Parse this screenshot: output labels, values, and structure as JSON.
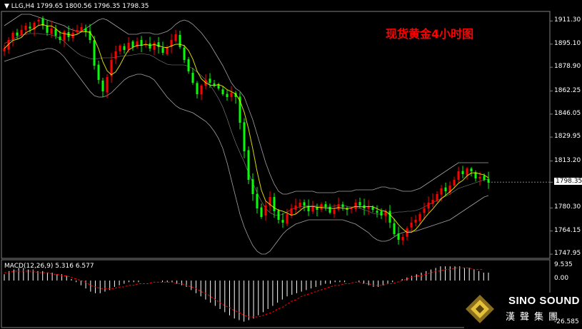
{
  "header": {
    "symbol": "LLG,H4",
    "ohlc": "1799.65 1800.56 1796.35 1798.35",
    "title": "现货黄金4小时图"
  },
  "macd": {
    "label": "MACD(12,26,9) 5.316 6.577",
    "tick_labels": [
      "9.535",
      "0.00",
      "-26.585"
    ]
  },
  "logo": {
    "brand": "SINO SOUND",
    "sub": "漢聲集團"
  },
  "colors": {
    "background": "#000000",
    "up_candle": "#ff0000",
    "down_candle": "#00ff00",
    "ma_line": "#ffff00",
    "bollinger": "#c0c0c0",
    "macd_signal": "#ff0000",
    "macd_hist": "#ffffff",
    "title": "#ff0000"
  },
  "chart_data": [
    {
      "type": "candlestick",
      "title": "现货黄金4小时图",
      "ylim": [
        1745,
        1918
      ],
      "y_ticks": [
        "1911.30",
        "1895.10",
        "1878.90",
        "1862.25",
        "1846.05",
        "1829.95",
        "1813.20",
        "1798.35",
        "1780.30",
        "1764.15",
        "1747.95"
      ],
      "current_price": 1798.35,
      "close": [
        1892,
        1898,
        1903,
        1901,
        1905,
        1908,
        1906,
        1910,
        1912,
        1908,
        1903,
        1906,
        1901,
        1898,
        1904,
        1900,
        1903,
        1905,
        1907,
        1904,
        1898,
        1880,
        1870,
        1862,
        1872,
        1884,
        1890,
        1894,
        1891,
        1896,
        1893,
        1897,
        1894,
        1895,
        1892,
        1896,
        1893,
        1889,
        1893,
        1898,
        1902,
        1893,
        1884,
        1876,
        1868,
        1860,
        1866,
        1870,
        1868,
        1866,
        1864,
        1860,
        1858,
        1861,
        1858,
        1840,
        1820,
        1800,
        1790,
        1780,
        1774,
        1782,
        1788,
        1778,
        1772,
        1770,
        1776,
        1780,
        1782,
        1784,
        1782,
        1778,
        1781,
        1779,
        1783,
        1781,
        1777,
        1779,
        1783,
        1781,
        1779,
        1780,
        1784,
        1782,
        1780,
        1781,
        1779,
        1777,
        1775,
        1778,
        1770,
        1762,
        1758,
        1760,
        1766,
        1770,
        1772,
        1776,
        1780,
        1784,
        1786,
        1790,
        1794,
        1792,
        1796,
        1800,
        1806,
        1804,
        1808,
        1806,
        1801,
        1802,
        1800,
        1798
      ],
      "bollinger_upper": [
        1908,
        1910,
        1912,
        1914,
        1916,
        1916,
        1916,
        1915,
        1914,
        1913,
        1912,
        1911,
        1910,
        1909,
        1908,
        1906,
        1905,
        1904,
        1904,
        1906,
        1908,
        1910,
        1912,
        1913,
        1912,
        1910,
        1908,
        1906,
        1904,
        1902,
        1902,
        1902,
        1903,
        1903,
        1903,
        1902,
        1902,
        1903,
        1904,
        1906,
        1909,
        1911,
        1912,
        1911,
        1909,
        1906,
        1903,
        1899,
        1895,
        1890,
        1885,
        1880,
        1874,
        1868,
        1864,
        1862,
        1858,
        1850,
        1842,
        1832,
        1822,
        1812,
        1804,
        1797,
        1792,
        1790,
        1790,
        1791,
        1792,
        1792,
        1792,
        1792,
        1792,
        1791,
        1791,
        1791,
        1791,
        1791,
        1792,
        1792,
        1792,
        1792,
        1793,
        1793,
        1793,
        1793,
        1793,
        1794,
        1795,
        1795,
        1794,
        1794,
        1793,
        1792,
        1792,
        1792,
        1793,
        1794,
        1796,
        1798,
        1800,
        1802,
        1804,
        1806,
        1808,
        1810,
        1812,
        1812,
        1812,
        1812,
        1812,
        1812,
        1812,
        1812
      ],
      "bollinger_lower": [
        1883,
        1884,
        1885,
        1886,
        1887,
        1888,
        1889,
        1890,
        1891,
        1891,
        1892,
        1892,
        1891,
        1889,
        1886,
        1882,
        1878,
        1874,
        1870,
        1866,
        1862,
        1859,
        1858,
        1858,
        1859,
        1861,
        1864,
        1867,
        1870,
        1872,
        1873,
        1874,
        1874,
        1873,
        1872,
        1870,
        1866,
        1862,
        1858,
        1855,
        1852,
        1850,
        1849,
        1848,
        1847,
        1845,
        1843,
        1841,
        1838,
        1834,
        1829,
        1822,
        1812,
        1800,
        1788,
        1776,
        1767,
        1760,
        1754,
        1750,
        1748,
        1748,
        1750,
        1754,
        1758,
        1762,
        1765,
        1767,
        1769,
        1770,
        1771,
        1772,
        1772,
        1772,
        1772,
        1772,
        1772,
        1772,
        1772,
        1772,
        1771,
        1770,
        1769,
        1767,
        1765,
        1763,
        1760,
        1758,
        1757,
        1757,
        1758,
        1760,
        1762,
        1763,
        1764,
        1764,
        1764,
        1765,
        1766,
        1767,
        1768,
        1769,
        1770,
        1771,
        1772,
        1774,
        1776,
        1778,
        1780,
        1782,
        1784,
        1786,
        1788,
        1789
      ]
    },
    {
      "type": "macd",
      "title": "MACD(12,26,9)",
      "macd_value": 5.316,
      "signal_value": 6.577,
      "ylim": [
        -26.585,
        9.535
      ],
      "histogram": [
        4,
        6,
        7,
        8,
        8,
        7,
        7,
        6,
        6,
        5,
        5,
        4,
        4,
        3,
        1,
        -1,
        -3,
        -5,
        -7,
        -8,
        -8,
        -7,
        -6,
        -4,
        -3,
        -2,
        -1,
        -1,
        -1,
        0,
        0,
        0,
        0,
        -1,
        -1,
        -1,
        -2,
        -3,
        -4,
        -6,
        -8,
        -10,
        -12,
        -14,
        -16,
        -18,
        -20,
        -22,
        -24,
        -25,
        -26,
        -25,
        -24,
        -22,
        -20,
        -18,
        -16,
        -14,
        -12,
        -10,
        -9,
        -8,
        -7,
        -6,
        -5,
        -4,
        -3,
        -2,
        -2,
        -1,
        -1,
        -1,
        0,
        0,
        -1,
        -2,
        -3,
        -4,
        -4,
        -3,
        -2,
        -1,
        0,
        1,
        2,
        3,
        4,
        5,
        6,
        7,
        8,
        9,
        9,
        9,
        9,
        9,
        8,
        8,
        7,
        6,
        5,
        5
      ],
      "signal": [
        5,
        5,
        6,
        6,
        6,
        6,
        6,
        5,
        5,
        5,
        4,
        4,
        3,
        3,
        2,
        1,
        0,
        -1,
        -3,
        -4,
        -5,
        -5,
        -5,
        -5,
        -4,
        -4,
        -3,
        -3,
        -2,
        -2,
        -2,
        -1,
        -1,
        -1,
        -1,
        -1,
        -2,
        -2,
        -3,
        -4,
        -5,
        -7,
        -8,
        -10,
        -12,
        -14,
        -16,
        -17,
        -19,
        -20,
        -22,
        -23,
        -23,
        -23,
        -22,
        -21,
        -20,
        -18,
        -17,
        -15,
        -13,
        -12,
        -10,
        -9,
        -8,
        -7,
        -6,
        -5,
        -4,
        -3,
        -3,
        -2,
        -2,
        -1,
        -1,
        -2,
        -2,
        -3,
        -3,
        -3,
        -2,
        -2,
        -1,
        0,
        1,
        2,
        3,
        3,
        4,
        5,
        6,
        6,
        7,
        7,
        8,
        8,
        8,
        8,
        7,
        7,
        7
      ]
    }
  ]
}
